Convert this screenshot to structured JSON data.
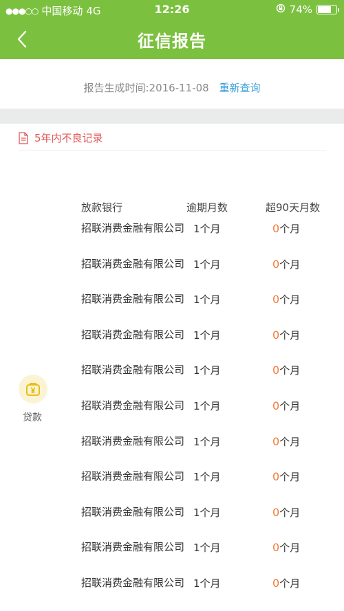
{
  "status_bar": {
    "carrier": "中国移动",
    "network": "4G",
    "time": "12:26",
    "battery": "74%",
    "battery_level": 0.74
  },
  "nav": {
    "title": "征信报告"
  },
  "report": {
    "generated_label": "报告生成时间:2016-11-08",
    "requery": "重新查询"
  },
  "section": {
    "title": "5年内不良记录"
  },
  "loan": {
    "label": "贷款",
    "columns": [
      "放款银行",
      "逾期月数",
      "超90天月数"
    ],
    "rows": [
      {
        "bank": "招联消费金融有限公司",
        "overdue": "1个月",
        "over90_num": "0",
        "over90_unit": "个月"
      },
      {
        "bank": "招联消费金融有限公司",
        "overdue": "1个月",
        "over90_num": "0",
        "over90_unit": "个月"
      },
      {
        "bank": "招联消费金融有限公司",
        "overdue": "1个月",
        "over90_num": "0",
        "over90_unit": "个月"
      },
      {
        "bank": "招联消费金融有限公司",
        "overdue": "1个月",
        "over90_num": "0",
        "over90_unit": "个月"
      },
      {
        "bank": "招联消费金融有限公司",
        "overdue": "1个月",
        "over90_num": "0",
        "over90_unit": "个月"
      },
      {
        "bank": "招联消费金融有限公司",
        "overdue": "1个月",
        "over90_num": "0",
        "over90_unit": "个月"
      },
      {
        "bank": "招联消费金融有限公司",
        "overdue": "1个月",
        "over90_num": "0",
        "over90_unit": "个月"
      },
      {
        "bank": "招联消费金融有限公司",
        "overdue": "1个月",
        "over90_num": "0",
        "over90_unit": "个月"
      },
      {
        "bank": "招联消费金融有限公司",
        "overdue": "1个月",
        "over90_num": "0",
        "over90_unit": "个月"
      },
      {
        "bank": "招联消费金融有限公司",
        "overdue": "1个月",
        "over90_num": "0",
        "over90_unit": "个月"
      },
      {
        "bank": "招联消费金融有限公司",
        "overdue": "1个月",
        "over90_num": "0",
        "over90_unit": "个月"
      }
    ]
  },
  "colors": {
    "brand_green": "#7bc13f",
    "link_blue": "#3a9fd8",
    "alert_red": "#e25555",
    "number_orange": "#f07a36"
  },
  "icons": {
    "back": "chevron-left-icon",
    "orientation_lock": "orientation-lock-icon",
    "document": "document-icon",
    "loan": "money-bag-icon"
  }
}
